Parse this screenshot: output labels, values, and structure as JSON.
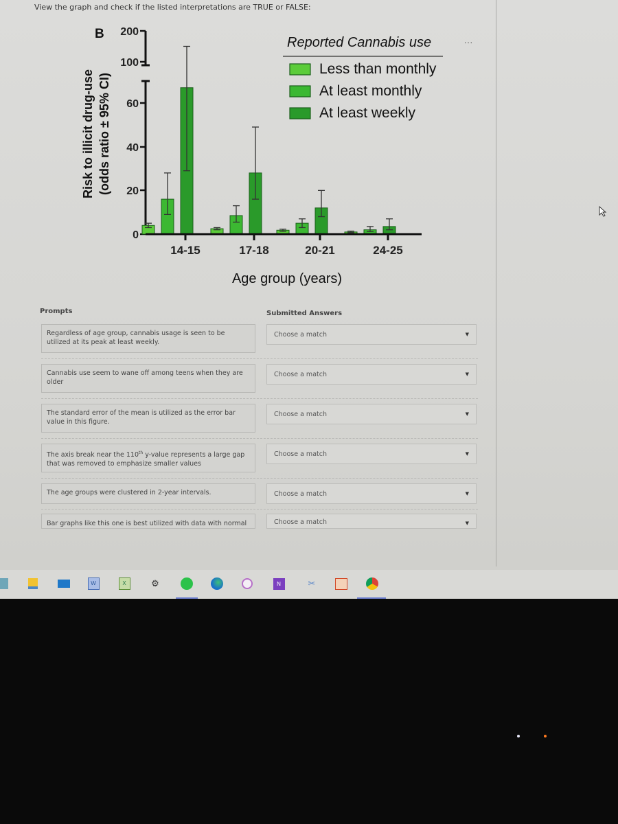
{
  "instruction": "View the graph and check if the listed interpretations are TRUE or FALSE:",
  "more_menu": "...",
  "chart_data": {
    "type": "bar",
    "panel_label": "B",
    "title": "Reported Cannabis use",
    "xlabel": "Age group (years)",
    "ylabel_line1": "Risk to illicit drug-use",
    "ylabel_line2": "(odds ratio ± 95% CI)",
    "categories": [
      "14-15",
      "17-18",
      "20-21",
      "24-25"
    ],
    "y_ticks": [
      "0",
      "20",
      "40",
      "60",
      "100",
      "200"
    ],
    "y_axis_break": true,
    "ylim": [
      0,
      200
    ],
    "legend_position": "top-right",
    "series": [
      {
        "name": "Less than monthly",
        "color": "#5ccc3a",
        "values": [
          4,
          2.5,
          1.8,
          1
        ],
        "ci_low": [
          3,
          2,
          1.3,
          0.7
        ],
        "ci_high": [
          5,
          3,
          2.3,
          1.4
        ]
      },
      {
        "name": "At least monthly",
        "color": "#3cb832",
        "values": [
          16,
          8.5,
          5,
          2
        ],
        "ci_low": [
          9,
          5.5,
          3,
          1.2
        ],
        "ci_high": [
          28,
          13,
          7,
          3.5
        ]
      },
      {
        "name": "At least weekly",
        "color": "#2a9a2a",
        "values": [
          67,
          28,
          12,
          3.5
        ],
        "ci_low": [
          29,
          16,
          8,
          2
        ],
        "ci_high": [
          150,
          49,
          20,
          7
        ]
      }
    ]
  },
  "matching": {
    "prompts_header": "Prompts",
    "answers_header": "Submitted Answers",
    "rows": [
      {
        "prompt": "Regardless of age group, cannabis usage is seen to be utilized at its peak at least weekly.",
        "answer": "Choose a match"
      },
      {
        "prompt": "Cannabis use seem to wane off among teens when they are older",
        "answer": "Choose a match"
      },
      {
        "prompt": "The standard error of the mean is utilized as the error bar value in this figure.",
        "answer": "Choose a match"
      },
      {
        "prompt_pre": "The axis break near the 110",
        "prompt_sup": "th",
        "prompt_post": " y-value represents a large gap that was removed to emphasize smaller values",
        "answer": "Choose a match"
      },
      {
        "prompt": "The age groups were clustered in 2-year intervals.",
        "answer": "Choose a match"
      },
      {
        "prompt": "Bar graphs like this one is best utilized with data with normal",
        "answer": "Choose a match"
      }
    ]
  },
  "taskbar": {
    "icons": [
      "task-view",
      "file-explorer",
      "mail",
      "word",
      "excel",
      "settings",
      "spotify",
      "edge",
      "itunes",
      "onenote",
      "snipping-tool",
      "powerpoint",
      "chrome"
    ],
    "active": [
      "spotify",
      "chrome"
    ]
  }
}
